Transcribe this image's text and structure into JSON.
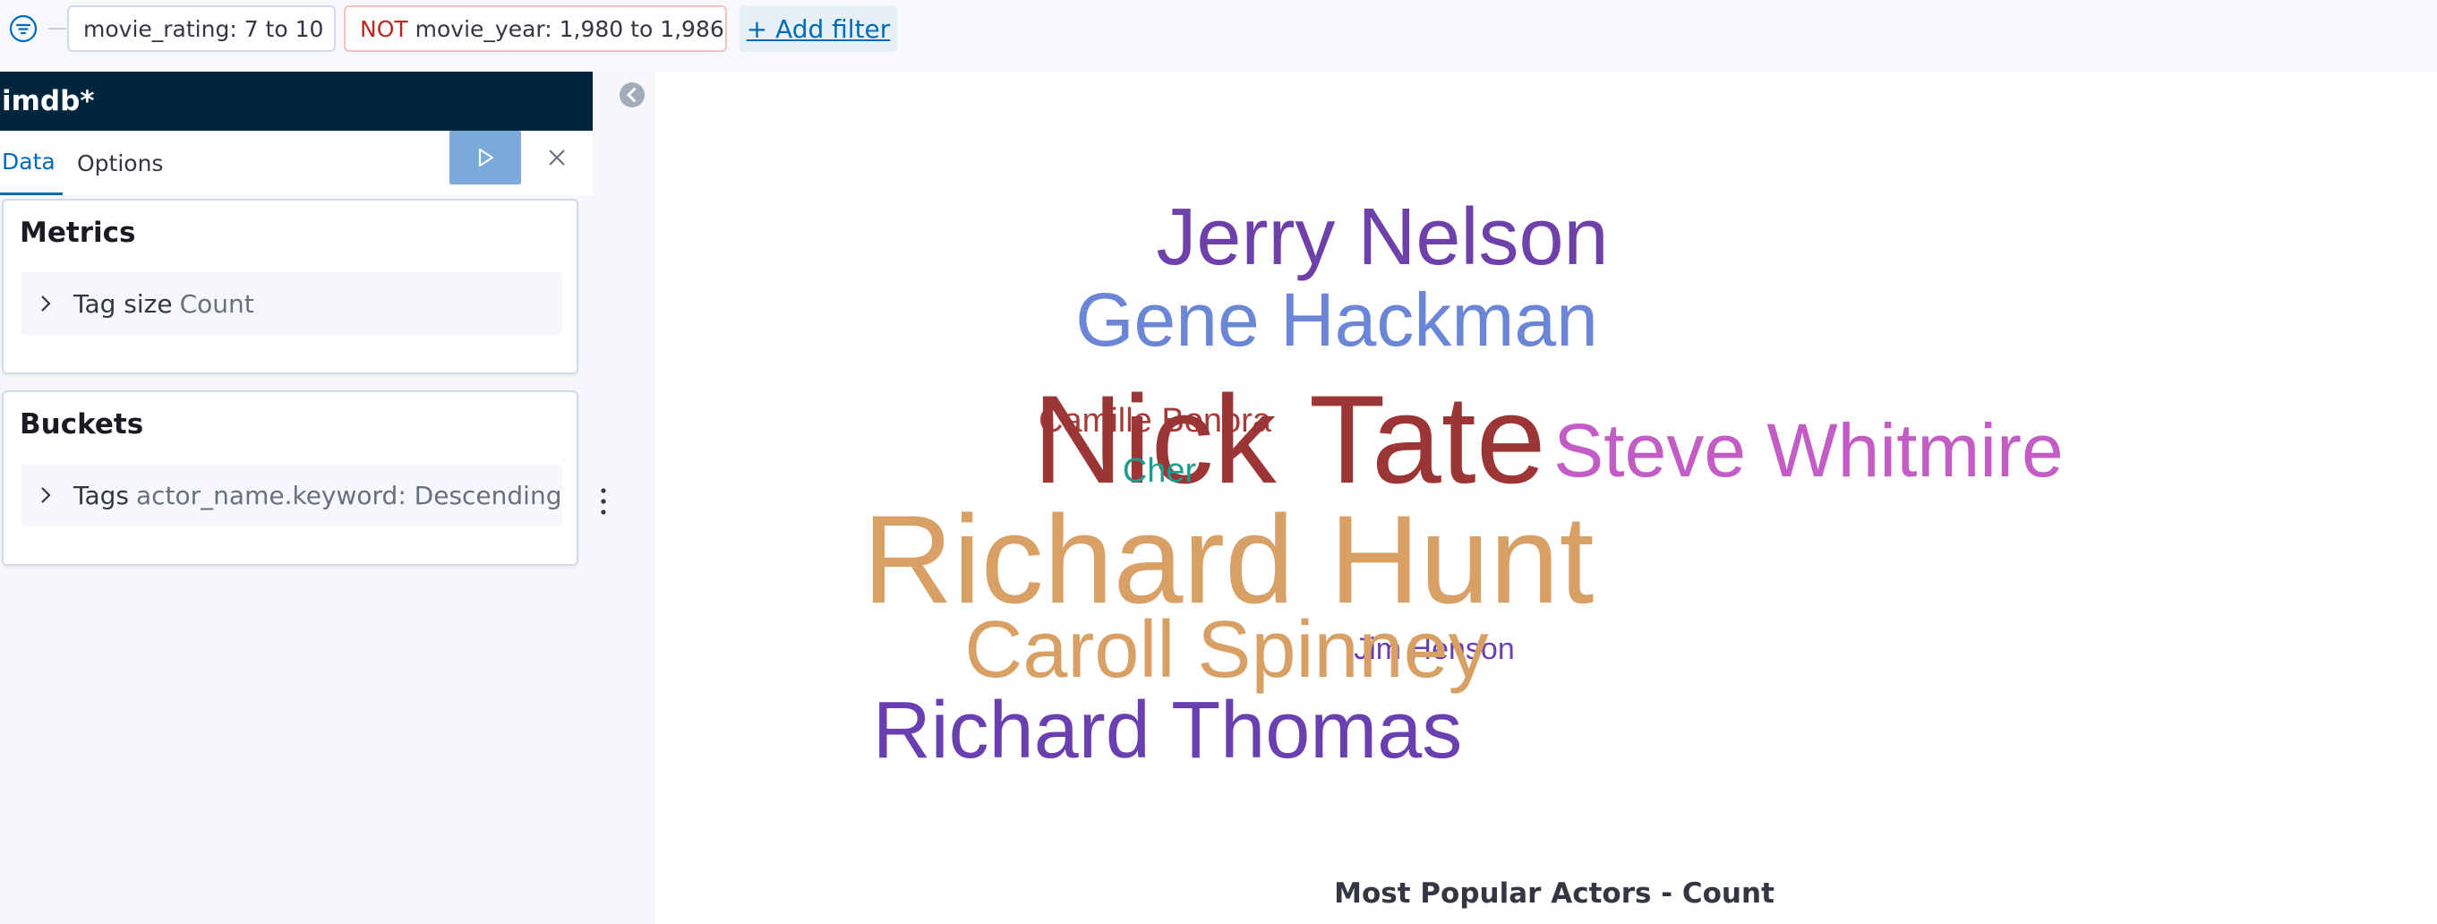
{
  "filters": [
    {
      "label": "movie_rating: 7 to 10",
      "negated": false
    },
    {
      "not_label": "NOT",
      "label": "movie_year: 1,980 to 1,986",
      "negated": true
    }
  ],
  "add_filter_label": "+ Add filter",
  "sidebar": {
    "index_pattern": "imdb*",
    "tabs": [
      {
        "label": "Data",
        "active": true
      },
      {
        "label": "Options",
        "active": false
      }
    ],
    "metrics": {
      "title": "Metrics",
      "aggregation": {
        "type": "Tag size",
        "description": "Count"
      }
    },
    "buckets": {
      "title": "Buckets",
      "aggregation": {
        "type": "Tags",
        "description": "actor_name.keyword: Descending"
      }
    }
  },
  "visualization": {
    "title": "Most Popular Actors - Count",
    "tags": [
      {
        "text": "Jerry Nelson",
        "color": "#6e40aa"
      },
      {
        "text": "Gene Hackman",
        "color": "#6b86d7"
      },
      {
        "text": "Camille Bonora",
        "color": "#a43c3a"
      },
      {
        "text": "Nick Tate",
        "color": "#9c3535"
      },
      {
        "text": "Steve Whitmire",
        "color": "#c35cc4"
      },
      {
        "text": "Cher",
        "color": "#1a9e8d"
      },
      {
        "text": "Richard Hunt",
        "color": "#d9a065"
      },
      {
        "text": "Jim Henson",
        "color": "#6a3fb0"
      },
      {
        "text": "Caroll Spinney",
        "color": "#d9a065"
      },
      {
        "text": "Richard Thomas",
        "color": "#6a3fb0"
      }
    ]
  },
  "colors": {
    "header_bg": "#00263e",
    "accent": "#006bb8",
    "apply_button": "#79aad9",
    "negated_text": "#bd271e"
  }
}
